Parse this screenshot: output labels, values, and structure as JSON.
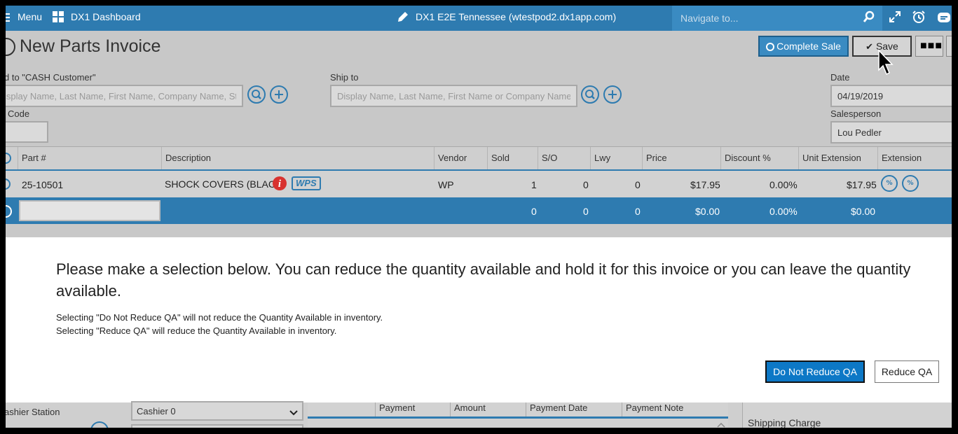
{
  "topbar": {
    "menu_label": "Menu",
    "dashboard_label": "DX1 Dashboard",
    "site_title": "DX1 E2E Tennessee (wtestpod2.dx1app.com)",
    "navigate_placeholder": "Navigate to..."
  },
  "page": {
    "title": "New Parts Invoice",
    "complete_sale_label": "Complete Sale",
    "save_label": "Save"
  },
  "form": {
    "sold_to_label": "d to  \"CASH Customer\"",
    "sold_to_placeholder": "isplay Name, Last Name, First Name, Company Name, Stor",
    "code_label": "Code",
    "ship_to_label": "Ship to",
    "ship_to_placeholder": "Display Name, Last Name, First Name or Company Name",
    "date_label": "Date",
    "date_value": "04/19/2019",
    "salesperson_label": "Salesperson",
    "salesperson_value": "Lou Pedler"
  },
  "table": {
    "columns": [
      "Part #",
      "Description",
      "Vendor",
      "Sold",
      "S/O",
      "Lwy",
      "Price",
      "Discount %",
      "Unit Extension",
      "Extension"
    ],
    "row": {
      "part": "25-10501",
      "description": "SHOCK COVERS (BLACK)",
      "brand_badge": "WPS",
      "vendor": "WP",
      "sold": "1",
      "so": "0",
      "lwy": "0",
      "price": "$17.95",
      "discount": "0.00%",
      "unit_ext": "$17.95"
    },
    "entry_row": {
      "sold": "0",
      "so": "0",
      "lwy": "0",
      "price": "$0.00",
      "discount": "0.00%",
      "unit_ext": "$0.00"
    }
  },
  "dialog": {
    "heading": "Please make a selection below. You can reduce the quantity available and hold it for this invoice or you can leave the quantity available.",
    "note1": "Selecting \"Do Not Reduce QA\" will not reduce the Quantity Available in inventory.",
    "note2": "Selecting \"Reduce QA\" will reduce the Quantity Available in inventory.",
    "btn_do_not_reduce": "Do Not Reduce QA",
    "btn_reduce": "Reduce QA"
  },
  "bottom": {
    "cashier_station_label": "ashier Station",
    "cashier_value": "Cashier 0",
    "payment_cols": [
      "Payment",
      "Amount",
      "Payment Date",
      "Payment Note"
    ],
    "shipping_label": "Shipping Charge"
  },
  "colors": {
    "topbar": "#2e7bb0",
    "accent_button": "#0d78c6",
    "danger_badge": "#d8322f"
  },
  "icons": [
    "hamburger-icon",
    "grid-icon",
    "pencil-icon",
    "search-icon",
    "expand-icon",
    "alarm-icon",
    "chat-icon",
    "add-circle-icon",
    "checkmark-icon",
    "more-icon",
    "cursor-pointer-icon",
    "info-badge-icon",
    "discount-icon",
    "tax-icon",
    "chevron-down-icon",
    "scroll-up-icon"
  ]
}
